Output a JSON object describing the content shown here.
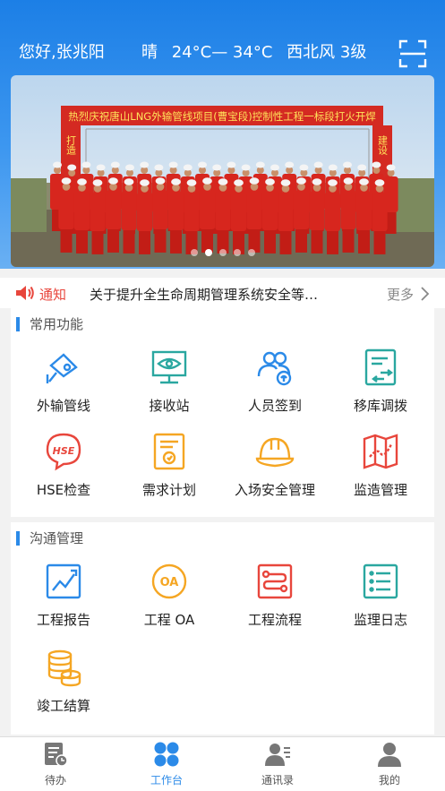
{
  "header": {
    "greeting": "您好,张兆阳",
    "weather": {
      "condition": "晴",
      "temperature": "24°C— 34°C",
      "wind": "西北风 3级"
    }
  },
  "banner": {
    "arch_title": "热烈庆祝唐山LNG外输管线项目(曹宝段)控制性工程一标段打火开焊",
    "left_pillar": "打造",
    "right_pillar": "建设",
    "dots": 5,
    "active_dot": 1
  },
  "notice": {
    "tag": "通知",
    "text": "关于提升全生命周期管理系统安全等…",
    "more": "更多"
  },
  "common_functions": {
    "title": "常用功能",
    "items": [
      {
        "label": "外输管线",
        "icon": "pipeline-camera-icon"
      },
      {
        "label": "接收站",
        "icon": "monitor-eye-icon"
      },
      {
        "label": "人员签到",
        "icon": "people-fingerprint-icon"
      },
      {
        "label": "移库调拨",
        "icon": "transfer-doc-icon"
      },
      {
        "label": "HSE检查",
        "icon": "hse-bubble-icon"
      },
      {
        "label": "需求计划",
        "icon": "plan-document-icon"
      },
      {
        "label": "入场安全管理",
        "icon": "helmet-icon"
      },
      {
        "label": "监造管理",
        "icon": "map-route-icon"
      }
    ]
  },
  "communication": {
    "title": "沟通管理",
    "items": [
      {
        "label": "工程报告",
        "icon": "report-chart-icon"
      },
      {
        "label": "工程 OA",
        "icon": "oa-circle-icon"
      },
      {
        "label": "工程流程",
        "icon": "flow-process-icon"
      },
      {
        "label": "监理日志",
        "icon": "log-list-icon"
      },
      {
        "label": "竣工结算",
        "icon": "coin-stack-icon"
      }
    ]
  },
  "tabbar": {
    "tabs": [
      {
        "label": "待办",
        "icon": "todo-icon"
      },
      {
        "label": "工作台",
        "icon": "workbench-icon"
      },
      {
        "label": "通讯录",
        "icon": "contacts-icon"
      },
      {
        "label": "我的",
        "icon": "profile-icon"
      }
    ],
    "active": 1
  },
  "colors": {
    "primary": "#2b8ae8",
    "notice": "#e8463c",
    "orange": "#f5a623",
    "teal": "#2aa7a0"
  }
}
